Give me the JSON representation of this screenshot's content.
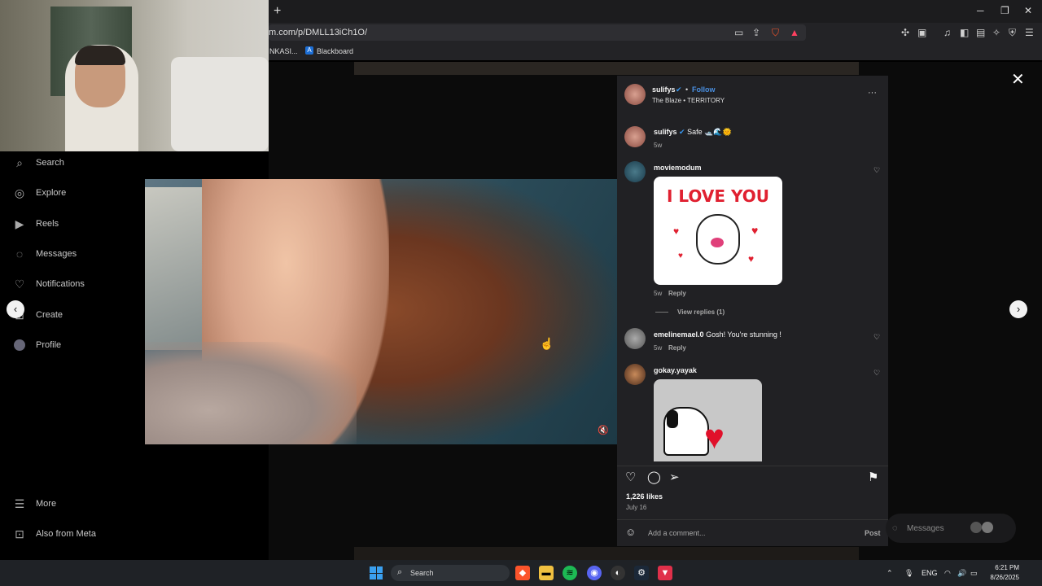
{
  "browser": {
    "new_tab": "+",
    "url": "m.com/p/DMLL13iCh1O/",
    "window_controls": {
      "minimize": "─",
      "maximize": "❐",
      "close": "✕"
    },
    "bookmarks": [
      {
        "label": "NKASI..."
      },
      {
        "label": "Blackboard",
        "icon_letter": "A"
      }
    ]
  },
  "sidebar": {
    "items": [
      {
        "label": "Search",
        "icon": "search-icon"
      },
      {
        "label": "Explore",
        "icon": "compass-icon"
      },
      {
        "label": "Reels",
        "icon": "reels-icon"
      },
      {
        "label": "Messages",
        "icon": "messenger-icon"
      },
      {
        "label": "Notifications",
        "icon": "heart-icon"
      },
      {
        "label": "Create",
        "icon": "plus-square-icon"
      },
      {
        "label": "Profile",
        "icon": "avatar-icon"
      }
    ],
    "bottom": [
      {
        "label": "More",
        "icon": "menu-icon"
      },
      {
        "label": "Also from Meta",
        "icon": "grid-icon"
      }
    ]
  },
  "post": {
    "author": "sulifys",
    "follow_label": "Follow",
    "dot": "•",
    "audio": "The Blaze • TERRITORY",
    "more": "···",
    "caption_user": "sulifys",
    "caption_text": "Safe 🛥️🌊🌞",
    "caption_time": "5w",
    "likes": "1,226 likes",
    "date": "July 16",
    "comment_placeholder": "Add a comment...",
    "post_button": "Post"
  },
  "comments": [
    {
      "user": "moviemodum",
      "text": "",
      "time": "5w",
      "reply": "Reply",
      "sticker_text": "I LOVE YOU",
      "view_replies": "View replies (1)"
    },
    {
      "user": "emelinemael.0",
      "text": "Gosh! You're stunning !",
      "time": "5w",
      "reply": "Reply"
    },
    {
      "user": "gokay.yayak",
      "text": ""
    }
  ],
  "messages_widget": {
    "label": "Messages"
  },
  "taskbar": {
    "search": "Search",
    "lang": "ENG",
    "time": "6:21 PM",
    "date": "8/26/2025"
  },
  "colors": {
    "accent_blue": "#4a90e2",
    "panel_bg": "#212124",
    "verified": "#3897f0"
  }
}
